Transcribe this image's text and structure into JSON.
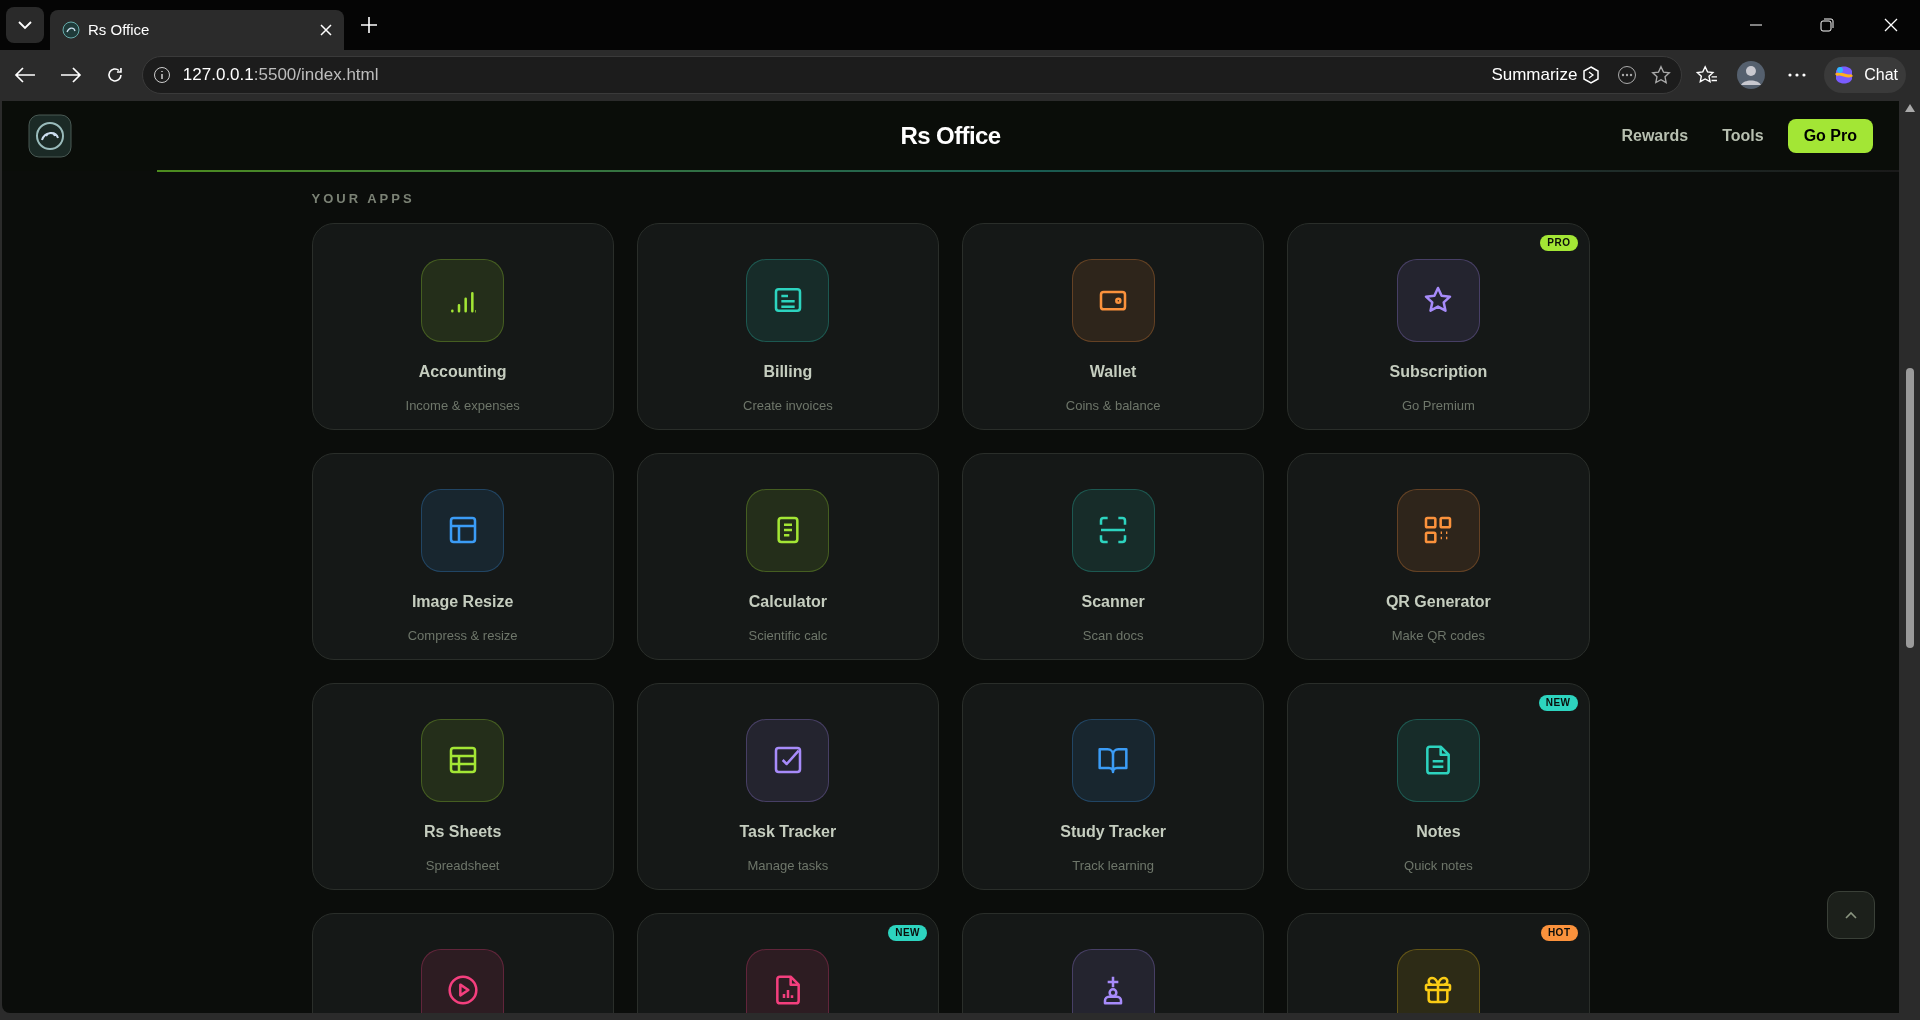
{
  "browser": {
    "tab_title": "Rs Office",
    "url_host": "127.0.0.1",
    "url_rest": ":5500/index.html",
    "summarize": "Summarize",
    "chat": "Chat"
  },
  "header": {
    "title": "Rs Office",
    "nav": [
      "Rewards",
      "Tools"
    ],
    "cta": "Go Pro"
  },
  "section_title": "YOUR APPS",
  "apps": [
    {
      "title": "Accounting",
      "subtitle": "Income & expenses",
      "kind": "bars",
      "color": "#a3e635"
    },
    {
      "title": "Billing",
      "subtitle": "Create invoices",
      "kind": "invoice",
      "color": "#2dd4bf"
    },
    {
      "title": "Wallet",
      "subtitle": "Coins & balance",
      "kind": "wallet",
      "color": "#fb923c"
    },
    {
      "title": "Subscription",
      "subtitle": "Go Premium",
      "kind": "star",
      "color": "#a78bfa",
      "badge": {
        "text": "PRO",
        "color": "#a3e635"
      }
    },
    {
      "title": "Image Resize",
      "subtitle": "Compress & resize",
      "kind": "layout",
      "color": "#3b9cf6"
    },
    {
      "title": "Calculator",
      "subtitle": "Scientific calc",
      "kind": "doc",
      "color": "#a3e635"
    },
    {
      "title": "Scanner",
      "subtitle": "Scan docs",
      "kind": "scan",
      "color": "#2dd4bf"
    },
    {
      "title": "QR Generator",
      "subtitle": "Make QR codes",
      "kind": "qr",
      "color": "#fb923c"
    },
    {
      "title": "Rs Sheets",
      "subtitle": "Spreadsheet",
      "kind": "table",
      "color": "#a3e635"
    },
    {
      "title": "Task Tracker",
      "subtitle": "Manage tasks",
      "kind": "check",
      "color": "#a78bfa"
    },
    {
      "title": "Study Tracker",
      "subtitle": "Track learning",
      "kind": "book",
      "color": "#3b9cf6"
    },
    {
      "title": "Notes",
      "subtitle": "Quick notes",
      "kind": "file",
      "color": "#2dd4bf",
      "badge": {
        "text": "NEW",
        "color": "#2dd4bf"
      }
    },
    {
      "kind": "play",
      "color": "#f43f7e"
    },
    {
      "kind": "filechart",
      "color": "#f43f7e",
      "badge": {
        "text": "NEW",
        "color": "#2dd4bf"
      }
    },
    {
      "kind": "person",
      "color": "#a78bfa"
    },
    {
      "kind": "gift",
      "color": "#facc15",
      "badge": {
        "text": "HOT",
        "color": "#fb923c"
      }
    }
  ]
}
